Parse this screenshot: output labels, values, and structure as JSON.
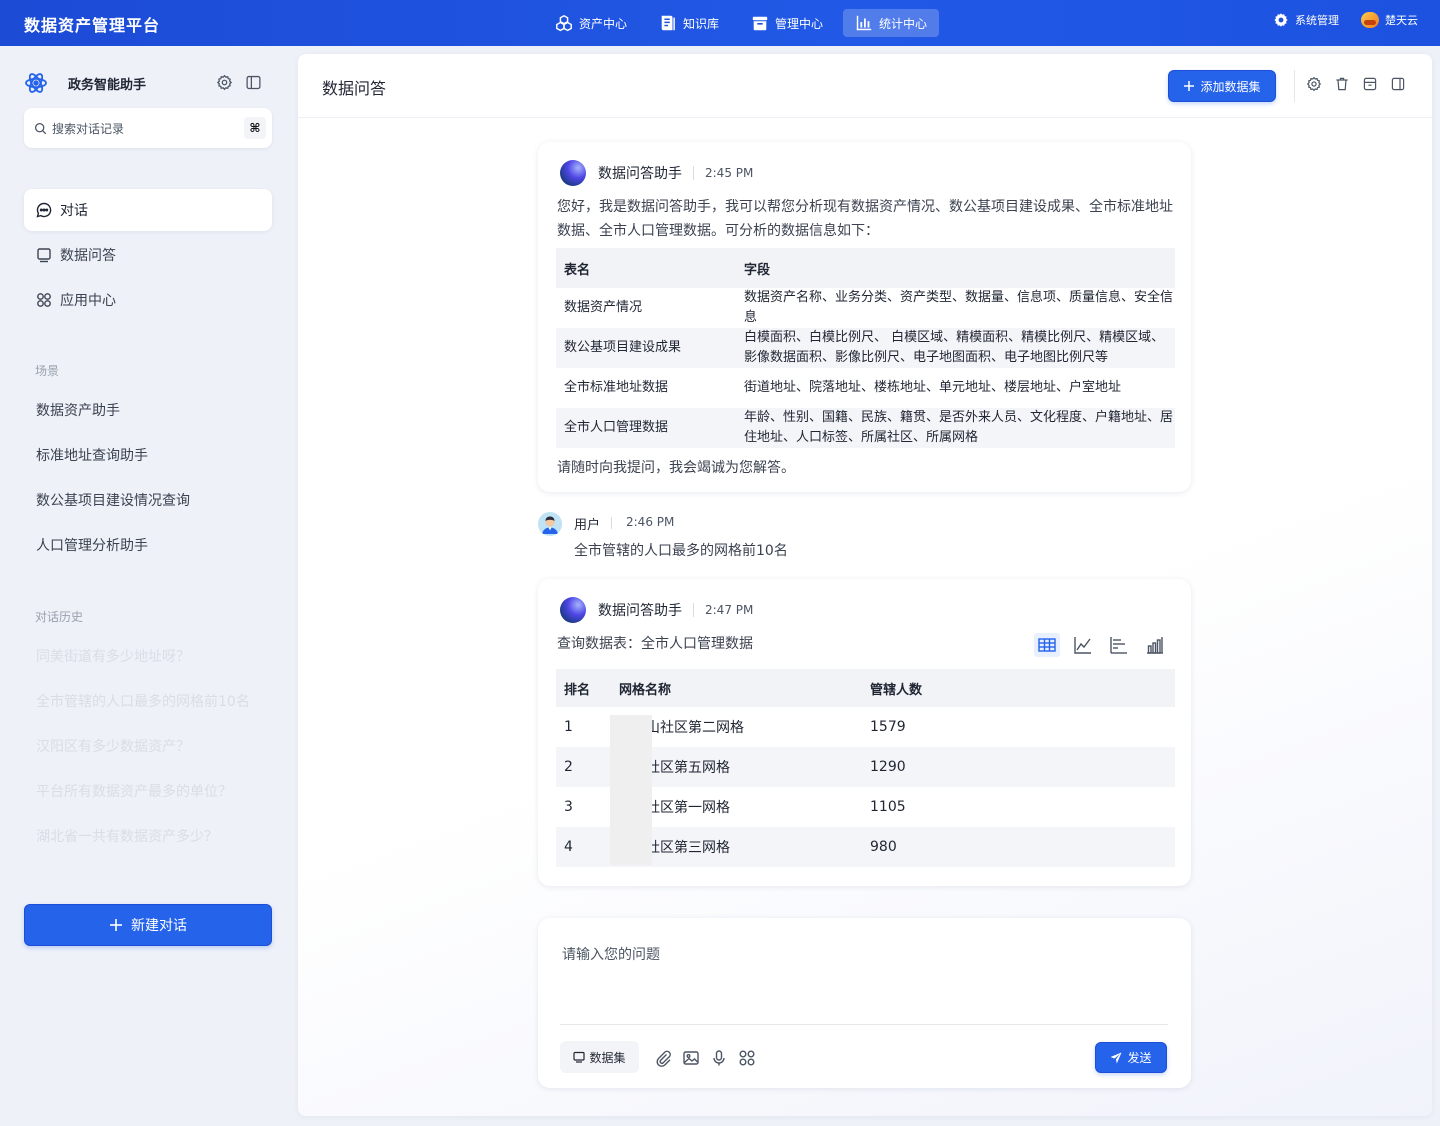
{
  "topbar": {
    "brand": "数据资产管理平台",
    "nav": [
      {
        "label": "资产中心",
        "icon": "cubes-icon"
      },
      {
        "label": "知识库",
        "icon": "book-icon"
      },
      {
        "label": "管理中心",
        "icon": "archive-icon"
      },
      {
        "label": "统计中心",
        "icon": "bar-chart-icon",
        "active": true
      }
    ],
    "system_label": "系统管理",
    "cloud_label": "楚天云"
  },
  "sidebar": {
    "assistant_title": "政务智能助手",
    "search_placeholder": "搜索对话记录",
    "search_shortcut": "⌘",
    "menu": [
      {
        "label": "对话",
        "icon": "chat-icon",
        "active": true
      },
      {
        "label": "数据问答",
        "icon": "dataset-icon"
      },
      {
        "label": "应用中心",
        "icon": "apps-icon"
      }
    ],
    "scene_label": "场景",
    "scenes": [
      "数据资产助手",
      "标准地址查询助手",
      "数公基项目建设情况查询",
      "人口管理分析助手"
    ],
    "history_label": "对话历史",
    "history": [
      "同美街道有多少地址呀？",
      "全市管辖的人口最多的网格前10名",
      "汉阳区有多少数据资产？",
      "平台所有数据资产最多的单位？",
      "湖北省一共有数据资产多少？"
    ],
    "new_chat_label": "新建对话"
  },
  "main": {
    "title": "数据问答",
    "add_dataset_label": "添加数据集",
    "header_icons": [
      "settings-icon",
      "delete-icon",
      "archive-icon",
      "panel-icon"
    ],
    "welcome": {
      "sender": "数据问答助手",
      "time": "2:45 PM",
      "intro": "您好，我是数据问答助手，我可以帮您分析现有数据资产情况、数公基项目建设成果、全市标准地址数据、全市人口管理数据。可分析的数据信息如下：",
      "table": {
        "headers": [
          "表名",
          "字段"
        ],
        "rows": [
          [
            "数据资产情况",
            "数据资产名称、业务分类、资产类型、数据量、信息项、质量信息、安全信息"
          ],
          [
            "数公基项目建设成果",
            "白模面积、白模比例尺、 白模区域、精模面积、精模比例尺、精模区域、影像数据面积、影像比例尺、电子地图面积、电子地图比例尺等"
          ],
          [
            "全市标准地址数据",
            "街道地址、院落地址、楼栋地址、单元地址、楼层地址、户室地址"
          ],
          [
            "全市人口管理数据",
            "年龄、性别、国籍、民族、籍贯、是否外来人员、文化程度、户籍地址、居住地址、人口标签、所属社区、所属网格"
          ]
        ]
      },
      "outro": "请随时向我提问，我会竭诚为您解答。"
    },
    "user_msg": {
      "sender": "用户",
      "time": "2:46 PM",
      "text": "全市管辖的人口最多的网格前10名"
    },
    "answer": {
      "sender": "数据问答助手",
      "time": "2:47 PM",
      "query_label": "查询数据表：全市人口管理数据",
      "view_modes": [
        "table-view-icon",
        "line-chart-icon",
        "horizontal-bar-icon",
        "bar-chart-icon"
      ],
      "table": {
        "headers": [
          "排名",
          "网格名称",
          "管辖人数"
        ],
        "rows": [
          [
            "1",
            "山社区第二网格",
            "1579"
          ],
          [
            "2",
            "社区第五网格",
            "1290"
          ],
          [
            "3",
            "社区第一网格",
            "1105"
          ],
          [
            "4",
            "社区第三网格",
            "980"
          ]
        ]
      }
    },
    "composer": {
      "placeholder": "请输入您的问题",
      "dataset_label": "数据集",
      "tools": [
        "attach-icon",
        "image-icon",
        "mic-icon",
        "apps-icon"
      ],
      "send_label": "发送"
    }
  },
  "colors": {
    "primary": "#2563eb",
    "topbar": "#1d4fd8",
    "background": "#eef1f8"
  }
}
